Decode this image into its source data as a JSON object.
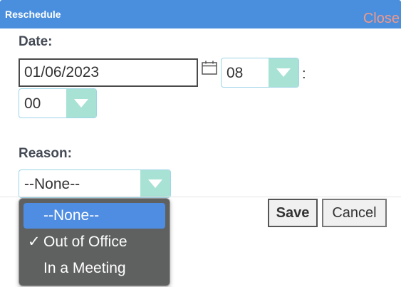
{
  "titlebar": {
    "title": "Reschedule",
    "close_label": "Close"
  },
  "date": {
    "label": "Date:",
    "value": "01/06/2023",
    "hour": "08",
    "separator": ":",
    "minute": "00"
  },
  "reason": {
    "label": "Reason:",
    "selected": "--None--",
    "options": [
      {
        "label": "--None--",
        "highlighted": true,
        "checked": false
      },
      {
        "label": "Out of Office",
        "highlighted": false,
        "checked": true
      },
      {
        "label": "In a Meeting",
        "highlighted": false,
        "checked": false
      }
    ],
    "check_mark": "✓"
  },
  "buttons": {
    "save": "Save",
    "cancel": "Cancel"
  },
  "colors": {
    "titlebar": "#4a8fde",
    "close_text": "#f0988a",
    "select_arrow_bg": "#a8e2d4",
    "dropdown_bg": "#5f6160",
    "dropdown_highlight": "#4f8de2"
  },
  "icons": {
    "calendar": "calendar-icon",
    "select_arrow": "chevron-down-icon"
  }
}
